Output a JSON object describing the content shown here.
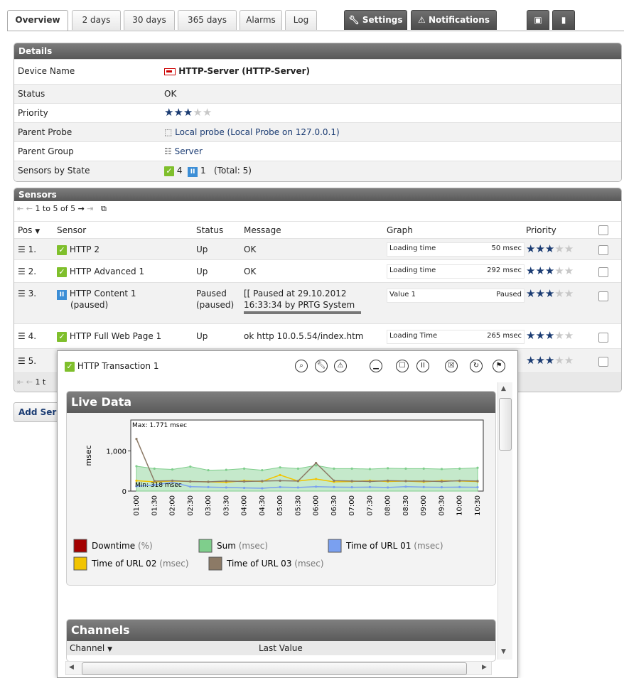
{
  "tabs": {
    "overview": "Overview",
    "days2": "2 days",
    "days30": "30 days",
    "days365": "365 days",
    "alarms": "Alarms",
    "log": "Log",
    "settings": "Settings",
    "notifications": "Notifications"
  },
  "details": {
    "title": "Details",
    "rows": [
      {
        "label": "Device Name",
        "value": "HTTP-Server (HTTP-Server)"
      },
      {
        "label": "Status",
        "value": "OK"
      },
      {
        "label": "Priority",
        "value": "",
        "stars": 3
      },
      {
        "label": "Parent Probe",
        "value": "Local probe (Local Probe on 127.0.0.1)"
      },
      {
        "label": "Parent Group",
        "value": "Server"
      },
      {
        "label": "Sensors by State",
        "value": ""
      }
    ],
    "state_up_count": "4",
    "state_paused_count": "1",
    "state_total": "(Total: 5)"
  },
  "sensors": {
    "title": "Sensors",
    "pager": "1 to 5 of 5",
    "columns": {
      "pos": "Pos",
      "sensor": "Sensor",
      "status": "Status",
      "message": "Message",
      "graph": "Graph",
      "priority": "Priority"
    },
    "rows": [
      {
        "pos": "1.",
        "name": "HTTP 2",
        "status": "Up",
        "message": "OK",
        "graph_label": "Loading time",
        "graph_value": "50 msec",
        "stars": 3
      },
      {
        "pos": "2.",
        "name": "HTTP Advanced 1",
        "status": "Up",
        "message": "OK",
        "graph_label": "Loading time",
        "graph_value": "292 msec",
        "stars": 3
      },
      {
        "pos": "3.",
        "name": "HTTP Content 1",
        "name2": "(paused)",
        "status": "Paused",
        "status2": "(paused)",
        "message": "[[ Paused at 29.10.2012",
        "message2": "16:33:34 by PRTG System",
        "graph_label": "Value 1",
        "graph_value": "Paused",
        "stars": 3
      },
      {
        "pos": "4.",
        "name": "HTTP Full Web Page 1",
        "status": "Up",
        "message": "ok http 10.0.5.54/index.htm",
        "graph_label": "Loading Time",
        "graph_value": "265 msec",
        "stars": 3
      },
      {
        "pos": "5.",
        "name": "",
        "status": "",
        "message": "",
        "graph_label": "",
        "graph_value": "",
        "stars": 3
      }
    ],
    "footer_pager": "1 t"
  },
  "add_sensor": "Add Ser",
  "popup": {
    "sensor_name": "HTTP Transaction 1",
    "live_data_title": "Live Data",
    "channels_title": "Channels",
    "channels_columns": {
      "channel": "Channel",
      "last_value": "Last Value"
    }
  },
  "chart_data": {
    "type": "line",
    "ylabel": "msec",
    "ylim": [
      0,
      1771
    ],
    "yticks": [
      "0",
      "1,000"
    ],
    "max_label": "Max: 1.771 msec",
    "min_label": "Min: 318 msec",
    "categories": [
      "01:00",
      "01:30",
      "02:00",
      "02:30",
      "03:00",
      "03:30",
      "04:00",
      "04:30",
      "05:00",
      "05:30",
      "06:00",
      "06:30",
      "07:00",
      "07:30",
      "08:00",
      "08:30",
      "09:00",
      "09:30",
      "10:00",
      "10:30"
    ],
    "series": [
      {
        "name": "Downtime",
        "unit": "(%)",
        "color": "#a30000",
        "values": [
          0,
          0,
          0,
          0,
          0,
          0,
          0,
          0,
          0,
          0,
          0,
          0,
          0,
          0,
          0,
          0,
          0,
          0,
          0,
          0
        ]
      },
      {
        "name": "Sum",
        "unit": "(msec)",
        "color": "#7fce8c",
        "values": [
          620,
          560,
          540,
          610,
          520,
          530,
          560,
          520,
          590,
          560,
          640,
          560,
          560,
          550,
          570,
          560,
          560,
          550,
          560,
          580
        ]
      },
      {
        "name": "Time of URL 01",
        "unit": "(msec)",
        "color": "#7aa0f0",
        "values": [
          120,
          150,
          220,
          110,
          100,
          90,
          80,
          70,
          100,
          90,
          110,
          100,
          95,
          100,
          90,
          110,
          100,
          95,
          100,
          95
        ]
      },
      {
        "name": "Time of URL 02",
        "unit": "(msec)",
        "color": "#f2c400",
        "values": [
          260,
          230,
          250,
          240,
          230,
          220,
          260,
          240,
          400,
          250,
          300,
          230,
          240,
          260,
          240,
          250,
          230,
          260,
          250,
          240
        ]
      },
      {
        "name": "Time of URL 03",
        "unit": "(msec)",
        "color": "#8c7a66",
        "values": [
          1300,
          250,
          260,
          240,
          230,
          250,
          240,
          250,
          260,
          250,
          700,
          260,
          250,
          240,
          260,
          250,
          250,
          240,
          260,
          250
        ]
      }
    ],
    "legend": "bottom"
  }
}
